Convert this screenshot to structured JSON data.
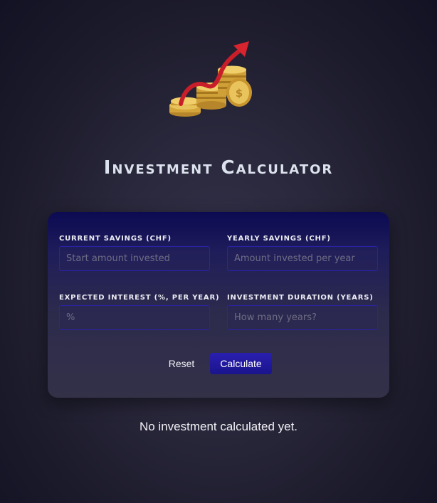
{
  "header": {
    "title": "Investment Calculator",
    "logo_icon": "investment-coins-arrow-icon"
  },
  "form": {
    "current_savings": {
      "label": "Current Savings (CHF)",
      "value": "",
      "placeholder": "Start amount invested"
    },
    "yearly_savings": {
      "label": "Yearly Savings (CHF)",
      "value": "",
      "placeholder": "Amount invested per year"
    },
    "expected_interest": {
      "label": "Expected Interest (%, per year)",
      "value": "",
      "placeholder": "%"
    },
    "duration": {
      "label": "Investment Duration (years)",
      "value": "",
      "placeholder": "How many years?"
    },
    "reset_label": "Reset",
    "calculate_label": "Calculate"
  },
  "result": {
    "message": "No investment calculated yet."
  },
  "colors": {
    "accent": "#1f18a0",
    "input_border": "#2a22a8",
    "card_top": "#0c0a52",
    "card_bottom": "#333148"
  }
}
